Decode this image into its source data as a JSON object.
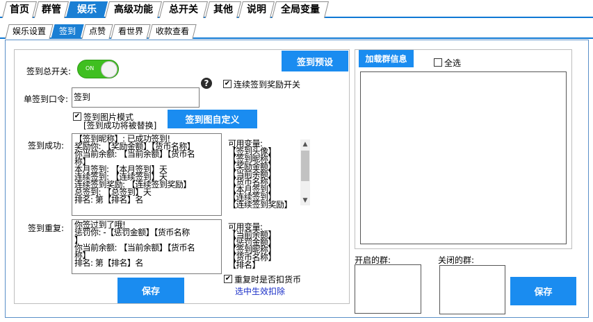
{
  "top_tabs": [
    "首页",
    "群管",
    "娱乐",
    "高级功能",
    "总开关",
    "其他",
    "说明",
    "全局变量"
  ],
  "sub_tabs": [
    "娱乐设置",
    "签到",
    "点赞",
    "看世界",
    "收款查看"
  ],
  "signin": {
    "master_switch_label": "签到总开关:",
    "toggle_text": "ON",
    "preset_button": "签到预设",
    "command_label": "单签到口令:",
    "command_value": "签到",
    "help_icon": "?",
    "continuous_reward_label": "连续签到奖励开关",
    "image_mode_label": "签到图片模式",
    "image_mode_note": "[签到成功将被替换]",
    "custom_image_button": "签到图自定义",
    "success_label": "签到成功:",
    "success_text": [
      "【签到昵称】: 已成功签到!",
      "奖励你: 【奖励金额】【货币名称】",
      "你当前余额: 【当前余额】【货币名",
      "称】",
      "本月签到: 【本月签到】天",
      "连续签到: 【连续签到】天",
      "连续签到奖励: 【连续签到奖励】",
      "总签到: 【总签到】天",
      "排名: 第【排名】名"
    ],
    "success_vars_title": "可用变量:",
    "success_vars": [
      "【签到头像】",
      "【签到昵称】",
      "【奖励金额】",
      "【当前余额】",
      "【货币名称】",
      "【本月签到】",
      "【连续签到】",
      "【连续签到奖励】"
    ],
    "repeat_label": "签到重复:",
    "repeat_text": [
      "你签过到了哦!",
      "惩罚你: -【惩罚金额】【货币名称",
      "】",
      "你当前余额: 【当前余额】【货币名",
      "称】",
      "排名: 第【排名】名"
    ],
    "repeat_vars_title": "可用变量:",
    "repeat_vars": [
      "【当前余额】",
      "【惩罚金额】",
      "【签到昵称】",
      "【货币名称】",
      "【排名】"
    ],
    "deduct_label": "重复时是否扣货币",
    "deduct_link": "选中生效扣除",
    "save_button": "保存"
  },
  "groups": {
    "load_button": "加载群信息",
    "select_all_label": "全选",
    "enabled_label": "开启的群:",
    "disabled_label": "关闭的群:",
    "save_button": "保存"
  },
  "colors": {
    "accent": "#1a8cf0",
    "toggle_on": "#3fbf20",
    "link": "#1a2fc8"
  }
}
